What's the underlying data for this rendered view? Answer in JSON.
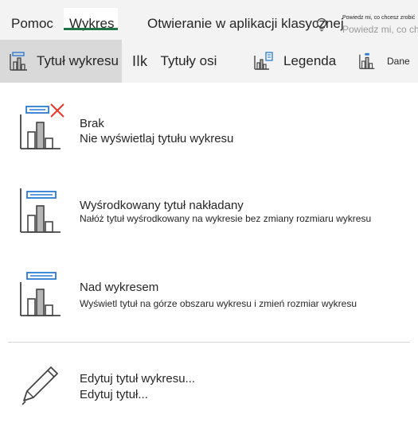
{
  "tabs": [
    {
      "label": "Pomoc",
      "active": false
    },
    {
      "label": "Wykres",
      "active": true
    },
    {
      "label": "Otwieranie w aplikacji klasycznej",
      "active": false
    }
  ],
  "tell_me": {
    "label": "Powiedz mi, co chcesz zrobić",
    "ghost_text": "Powiedz mi, co chcesz zrobić"
  },
  "toolbar": {
    "chart_title_label": "Tytuł wykresu",
    "axis_titles_prefix": "Ilk",
    "axis_titles_label": "Tytuły osi",
    "legend_label": "Legenda",
    "data_labels_label": "Dane"
  },
  "options": [
    {
      "title": "Brak",
      "description": "Nie wyświetlaj tytułu wykresu",
      "icon": "chart-no-title-icon"
    },
    {
      "title": "Wyśrodkowany tytuł nakładany",
      "description": "Nałóż tytuł wyśrodkowany na wykresie bez zmiany rozmiaru wykresu",
      "icon": "chart-centered-overlay-title-icon"
    },
    {
      "title": "Nad wykresem",
      "description": "Wyświetl tytuł na górze obszaru wykresu i zmień rozmiar wykresu",
      "icon": "chart-title-above-icon"
    },
    {
      "title": "Edytuj tytuł wykresu...",
      "description": "Edytuj tytuł...",
      "icon": "pencil-icon"
    }
  ],
  "colors": {
    "accent_blue": "#2b7cd3",
    "accent_red": "#e8382f",
    "active_underline": "#217346",
    "ribbon_bg": "#f3f3f3",
    "selected_bg": "#d9d9d9"
  }
}
